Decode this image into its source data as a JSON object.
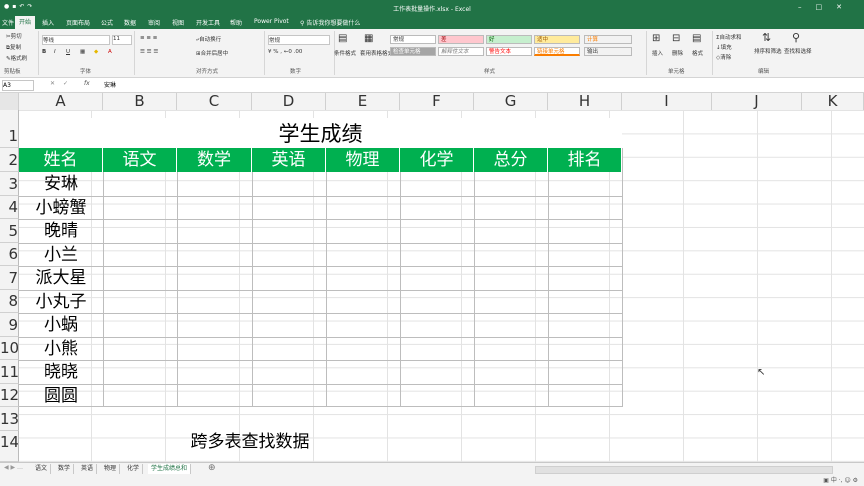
{
  "window": {
    "title": "工作表批量操作.xlsx - Excel",
    "qat_icons": [
      "autosave-icon",
      "save-icon",
      "undo-icon",
      "redo-icon"
    ],
    "controls": [
      "minimize-icon",
      "maximize-icon",
      "close-icon"
    ]
  },
  "ribbon_tabs": [
    "开始",
    "插入",
    "页面布局",
    "公式",
    "数据",
    "审阅",
    "视图",
    "开发工具",
    "帮助",
    "Power Pivot"
  ],
  "tell_me": "告诉我你想要做什么",
  "ribbon": {
    "clipboard": {
      "group": "剪贴板",
      "cut": "剪切",
      "copy": "复制",
      "painter": "格式刷"
    },
    "font": {
      "group": "字体",
      "font_name": "等线",
      "font_size": "11",
      "bold": "B",
      "italic": "I",
      "underline": "U"
    },
    "alignment": {
      "group": "对齐方式",
      "wrap": "自动换行",
      "merge": "合并后居中"
    },
    "number": {
      "group": "数字",
      "format": "常规"
    },
    "styles": {
      "group": "样式",
      "cond": "条件格式",
      "table": "套用表格格式",
      "s_normal": "常规",
      "s_bad": "差",
      "s_good": "好",
      "s_neutral": "适中",
      "s_calc": "计算",
      "s_check": "检查单元格",
      "s_explain": "解释性文本",
      "s_warn": "警告文本",
      "s_link": "链接单元格",
      "s_output": "输出"
    },
    "cells": {
      "group": "单元格",
      "insert": "插入",
      "delete": "删除",
      "format": "格式"
    },
    "editing": {
      "group": "编辑",
      "autosum": "自动求和",
      "fill": "填充",
      "clear": "清除",
      "sort": "排序和筛选",
      "find": "查找和选择"
    }
  },
  "formula_bar": {
    "name_box": "A3",
    "content": "安琳"
  },
  "columns": [
    "A",
    "B",
    "C",
    "D",
    "E",
    "F",
    "G",
    "H",
    "I",
    "J",
    "K"
  ],
  "rows": [
    "1",
    "2",
    "3",
    "4",
    "5",
    "6",
    "7",
    "8",
    "9",
    "10",
    "11",
    "12",
    "13",
    "14"
  ],
  "sheet": {
    "title": "学生成绩",
    "headers": [
      "姓名",
      "语文",
      "数学",
      "英语",
      "物理",
      "化学",
      "总分",
      "排名"
    ],
    "names": [
      "安琳",
      "小螃蟹",
      "晚晴",
      "小兰",
      "派大星",
      "小丸子",
      "小蜗",
      "小熊",
      "晓晓",
      "圆圆"
    ],
    "note": "跨多表查找数据"
  },
  "sheet_tabs": [
    "语文",
    "数学",
    "英语",
    "物理",
    "化学",
    "学生成绩总和"
  ],
  "active_sheet": "学生成绩总和",
  "colors": {
    "accent": "#217346",
    "header_fill": "#00b050"
  }
}
